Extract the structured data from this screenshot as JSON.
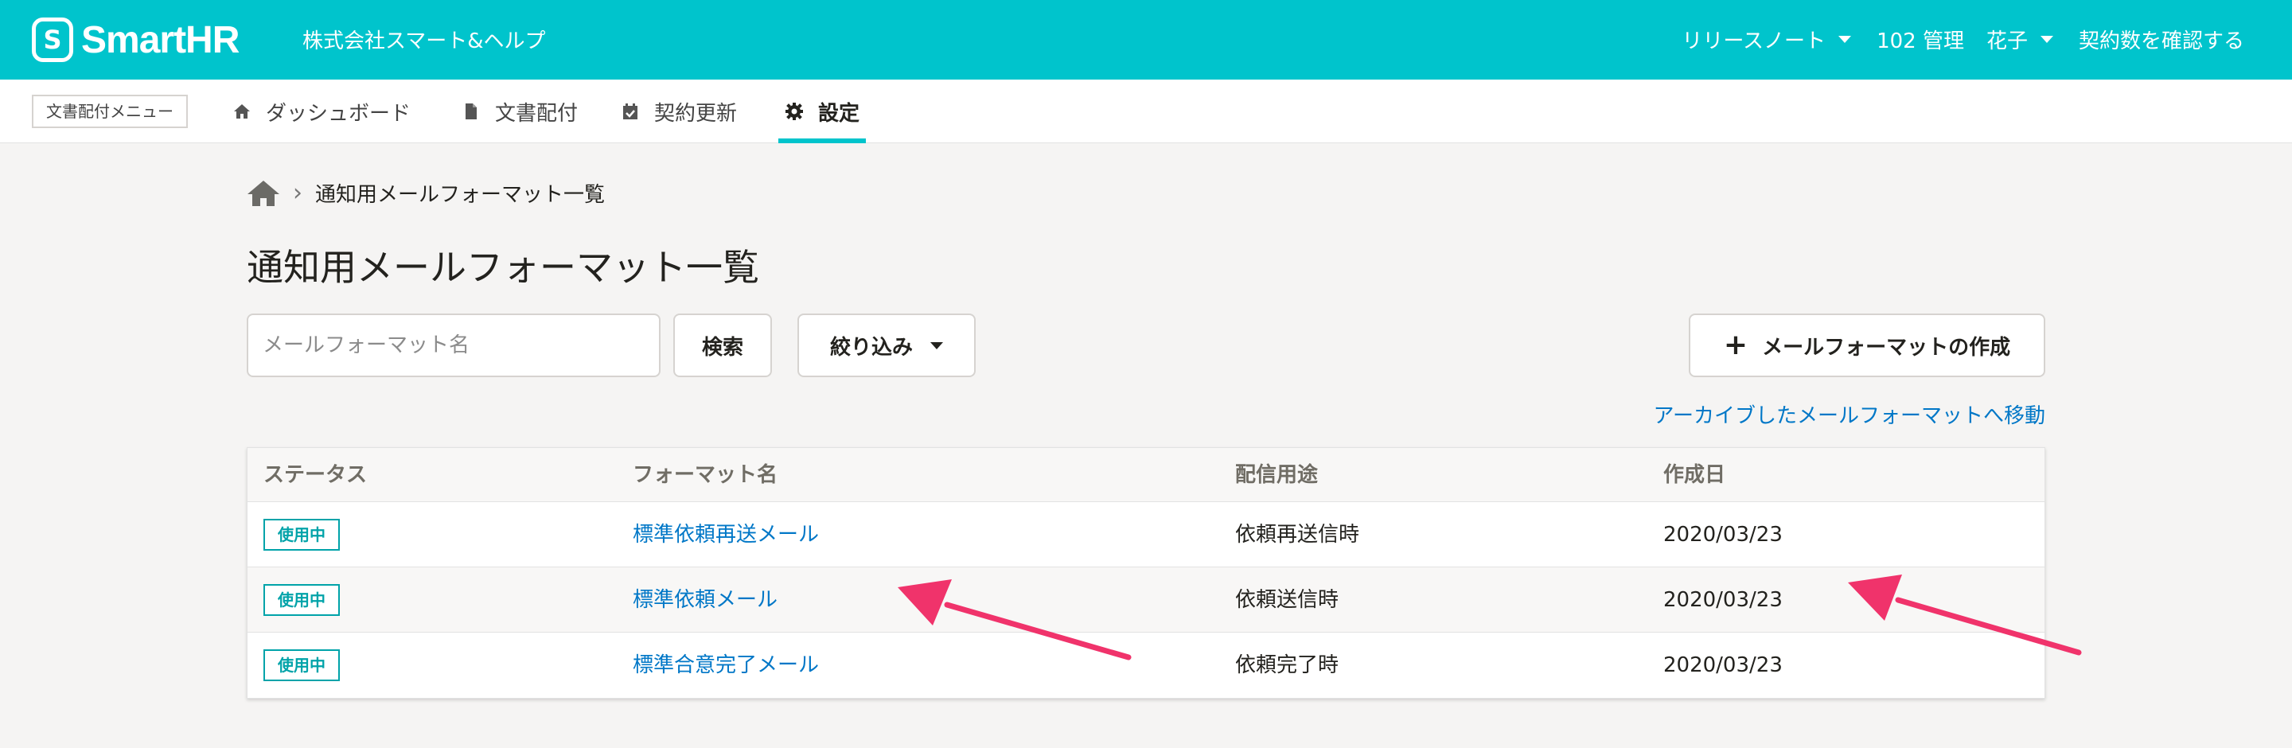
{
  "header": {
    "logo_text": "SmartHR",
    "company_name": "株式会社スマート&ヘルプ",
    "release_notes": "リリースノート",
    "user_id_role": "102 管理",
    "user_name": "花子",
    "contract_link": "契約数を確認する",
    "brand_color": "#00c4cc"
  },
  "nav": {
    "menu_label": "文書配付メニュー",
    "tabs": [
      {
        "label": "ダッシュボード",
        "icon": "home-icon",
        "active": false
      },
      {
        "label": "文書配付",
        "icon": "document-icon",
        "active": false
      },
      {
        "label": "契約更新",
        "icon": "calendar-check-icon",
        "active": false
      },
      {
        "label": "設定",
        "icon": "gear-icon",
        "active": true
      }
    ]
  },
  "breadcrumb": {
    "current": "通知用メールフォーマット一覧"
  },
  "page": {
    "title": "通知用メールフォーマット一覧"
  },
  "toolbar": {
    "search_placeholder": "メールフォーマット名",
    "search_button": "検索",
    "filter_button": "絞り込み",
    "create_button": "メールフォーマットの作成",
    "archive_link": "アーカイブしたメールフォーマットへ移動"
  },
  "table": {
    "columns": [
      "ステータス",
      "フォーマット名",
      "配信用途",
      "作成日"
    ],
    "rows": [
      {
        "status": "使用中",
        "name": "標準依頼再送メール",
        "usage": "依頼再送信時",
        "created": "2020/03/23"
      },
      {
        "status": "使用中",
        "name": "標準依頼メール",
        "usage": "依頼送信時",
        "created": "2020/03/23"
      },
      {
        "status": "使用中",
        "name": "標準合意完了メール",
        "usage": "依頼完了時",
        "created": "2020/03/23"
      }
    ]
  },
  "colors": {
    "accent": "#00c4cc",
    "link": "#0077c7",
    "status_badge": "#00a3a9",
    "annotation_arrow": "#f0336b"
  }
}
